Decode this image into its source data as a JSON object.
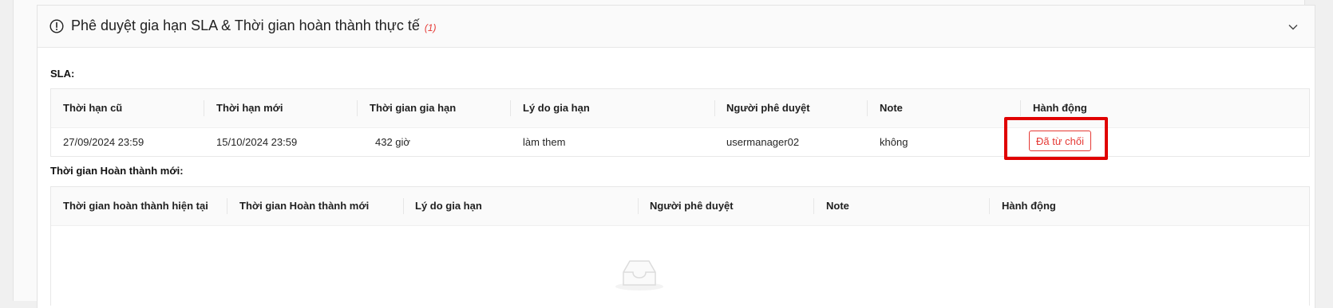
{
  "panel": {
    "title": "Phê duyệt gia hạn SLA & Thời gian hoàn thành thực tế",
    "count": "(1)"
  },
  "sla": {
    "label": "SLA:",
    "columns": [
      "Thời hạn cũ",
      "Thời hạn mới",
      "Thời gian gia hạn",
      "Lý do gia hạn",
      "Người phê duyệt",
      "Note",
      "Hành động"
    ],
    "rows": [
      {
        "old_deadline": "27/09/2024 23:59",
        "new_deadline": "15/10/2024 23:59",
        "extension": "432 giờ",
        "reason": "làm them",
        "approver": "usermanager02",
        "note": "không",
        "action": "Đã từ chối"
      }
    ]
  },
  "completion": {
    "label": "Thời gian Hoàn thành mới:",
    "columns": [
      "Thời gian hoàn thành hiện tại",
      "Thời gian Hoàn thành mới",
      "Lý do gia hạn",
      "Người phê duyệt",
      "Note",
      "Hành động"
    ],
    "rows": []
  },
  "colors": {
    "danger": "#e53935",
    "highlight": "#e00000",
    "header_bg": "#fafafa"
  },
  "icons": {
    "panel_icon": "exclamation-circle-icon",
    "collapse_icon": "chevron-down-icon",
    "empty_icon": "inbox-empty-icon"
  }
}
